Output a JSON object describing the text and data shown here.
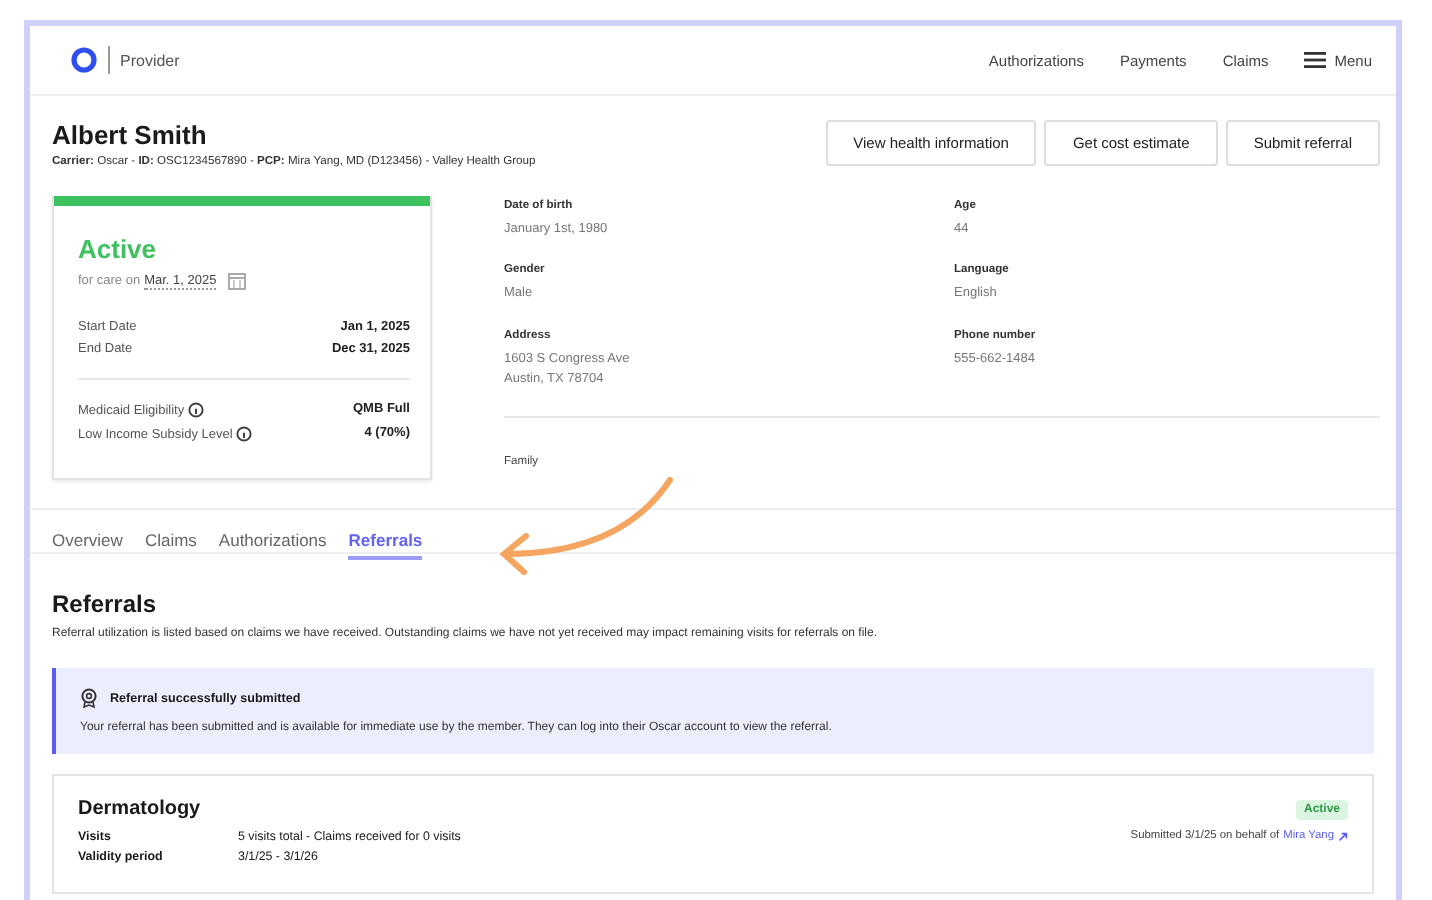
{
  "header": {
    "brand": "Provider",
    "nav": [
      "Authorizations",
      "Payments",
      "Claims"
    ],
    "menu": "Menu"
  },
  "member": {
    "name": "Albert Smith",
    "details": "**Carrier:** Oscar - **ID:** OSC1234567890 - **PCP:** Mira Yang, MD (D123456) - Valley Health Group"
  },
  "actions": [
    "View health information",
    "Get cost estimate",
    "Submit referral"
  ],
  "coverage": {
    "status": "Active",
    "care_label": "for care on",
    "care_date": "Mar. 1, 2025",
    "dates": [
      {
        "label": "Start Date",
        "value": "Jan 1, 2025"
      },
      {
        "label": "End Date",
        "value": "Dec 31, 2025"
      }
    ],
    "eligibility": [
      {
        "label": "Medicaid Eligibility",
        "value": "QMB Full"
      },
      {
        "label": "Low Income Subsidy Level",
        "value": "4 (70%)"
      }
    ]
  },
  "info": [
    {
      "label": "Date of birth",
      "value": "January 1st, 1980"
    },
    {
      "label": "Age",
      "value": "44"
    },
    {
      "label": "Gender",
      "value": "Male"
    },
    {
      "label": "Language",
      "value": "English"
    },
    {
      "label": "Address",
      "value": "1603 S Congress Ave\nAustin, TX 78704"
    },
    {
      "label": "Phone number",
      "value": "555-662-1484"
    }
  ],
  "family_label": "Family",
  "tabs": [
    {
      "label": "Overview",
      "selected": false
    },
    {
      "label": "Claims",
      "selected": false
    },
    {
      "label": "Authorizations",
      "selected": false
    },
    {
      "label": "Referrals",
      "selected": true
    }
  ],
  "referrals": {
    "title": "Referrals",
    "note": "Referral utilization is listed based on claims we have received. Outstanding claims we have not yet received may impact remaining visits for referrals on file.",
    "alert": {
      "title": "Referral successfully submitted",
      "body": "Your referral has been submitted and is available for immediate use by the member. They can log into their Oscar account to view the referral."
    },
    "cards": [
      {
        "title": "Dermatology",
        "status": "Active",
        "submitted": "Submitted 3/1/25 on behalf of",
        "provider": "Mira Yang",
        "rows": [
          {
            "label": "Visits",
            "value": "5 visits total - Claims received for 0 visits"
          },
          {
            "label": "Validity period",
            "value": "3/1/25 - 3/1/26"
          }
        ]
      }
    ]
  }
}
